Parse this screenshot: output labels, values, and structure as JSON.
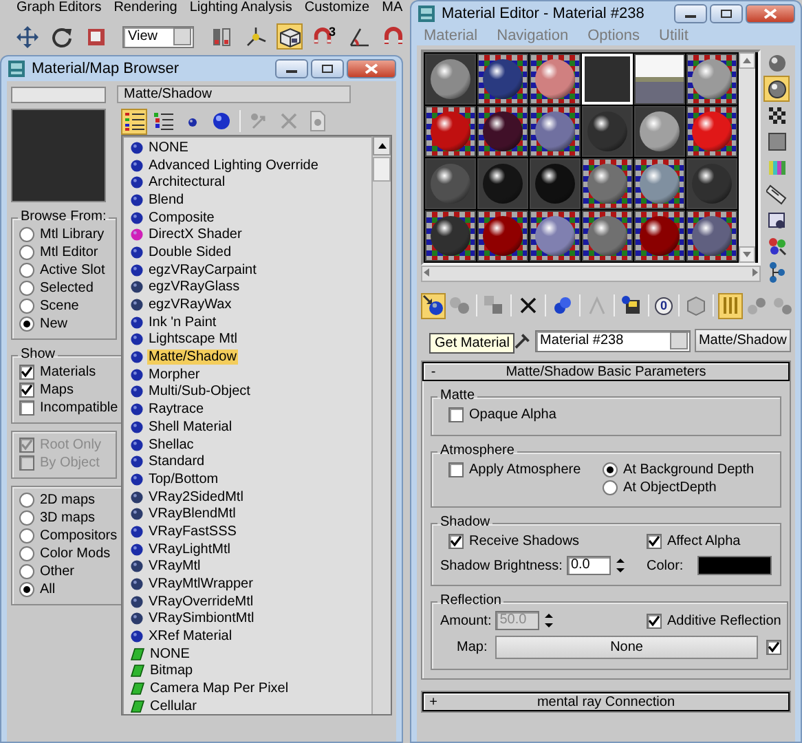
{
  "main_menu": [
    "Graph Editors",
    "Rendering",
    "Lighting Analysis",
    "Customize",
    "MA"
  ],
  "main_toolbar": {
    "tools": [
      {
        "active": false
      },
      {
        "active": false
      },
      {
        "active": false
      },
      {
        "active": false
      },
      {
        "active": false
      },
      {
        "active": true
      },
      {
        "active": false
      },
      {
        "active": false
      },
      {
        "active": false
      }
    ],
    "view": "View",
    "snap_label": "3"
  },
  "browser": {
    "title": "Material/Map Browser",
    "type_field": "Matte/Shadow",
    "toolbar": [
      {
        "active": true
      },
      {
        "active": false
      },
      {
        "active": false
      },
      {
        "active": false
      },
      {
        "active": false
      },
      {
        "active": false
      },
      {
        "active": false
      }
    ],
    "browse_from": {
      "title": "Browse From:",
      "options": [
        {
          "label": "Mtl Library",
          "selected": false
        },
        {
          "label": "Mtl Editor",
          "selected": false
        },
        {
          "label": "Active Slot",
          "selected": false
        },
        {
          "label": "Selected",
          "selected": false
        },
        {
          "label": "Scene",
          "selected": false
        },
        {
          "label": "New",
          "selected": true
        }
      ]
    },
    "show": {
      "title": "Show",
      "options": [
        {
          "label": "Materials",
          "checked": true
        },
        {
          "label": "Maps",
          "checked": true
        },
        {
          "label": "Incompatible",
          "checked": false
        }
      ]
    },
    "hierarchy": [
      {
        "label": "Root Only",
        "checked": true,
        "disabled": true
      },
      {
        "label": "By Object",
        "checked": false,
        "disabled": true
      }
    ],
    "categories": [
      {
        "label": "2D maps",
        "selected": false
      },
      {
        "label": "3D maps",
        "selected": false
      },
      {
        "label": "Compositors",
        "selected": false
      },
      {
        "label": "Color Mods",
        "selected": false
      },
      {
        "label": "Other",
        "selected": false
      },
      {
        "label": "All",
        "selected": true
      }
    ],
    "items": [
      {
        "label": "NONE",
        "kind": "material",
        "color": "#1c2da8",
        "selected": false
      },
      {
        "label": "Advanced Lighting Override",
        "kind": "material",
        "color": "#1c2da8",
        "selected": false
      },
      {
        "label": "Architectural",
        "kind": "material",
        "color": "#1c2da8",
        "selected": false
      },
      {
        "label": "Blend",
        "kind": "material",
        "color": "#1c2da8",
        "selected": false
      },
      {
        "label": "Composite",
        "kind": "material",
        "color": "#1c2da8",
        "selected": false
      },
      {
        "label": "DirectX Shader",
        "kind": "material",
        "color": "#d020b8",
        "selected": false
      },
      {
        "label": "Double Sided",
        "kind": "material",
        "color": "#1c2da8",
        "selected": false
      },
      {
        "label": "egzVRayCarpaint",
        "kind": "material",
        "color": "#1c2da8",
        "selected": false
      },
      {
        "label": "egzVRayGlass",
        "kind": "material",
        "color": "#2c3c6c",
        "selected": false
      },
      {
        "label": "egzVRayWax",
        "kind": "material",
        "color": "#2c3c6c",
        "selected": false
      },
      {
        "label": "Ink 'n Paint",
        "kind": "material",
        "color": "#1c2da8",
        "selected": false
      },
      {
        "label": "Lightscape Mtl",
        "kind": "material",
        "color": "#1c2da8",
        "selected": false
      },
      {
        "label": "Matte/Shadow",
        "kind": "material",
        "color": "#1c2da8",
        "selected": true
      },
      {
        "label": "Morpher",
        "kind": "material",
        "color": "#1c2da8",
        "selected": false
      },
      {
        "label": "Multi/Sub-Object",
        "kind": "material",
        "color": "#1c2da8",
        "selected": false
      },
      {
        "label": "Raytrace",
        "kind": "material",
        "color": "#1c2da8",
        "selected": false
      },
      {
        "label": "Shell Material",
        "kind": "material",
        "color": "#1c2da8",
        "selected": false
      },
      {
        "label": "Shellac",
        "kind": "material",
        "color": "#1c2da8",
        "selected": false
      },
      {
        "label": "Standard",
        "kind": "material",
        "color": "#1c2da8",
        "selected": false
      },
      {
        "label": "Top/Bottom",
        "kind": "material",
        "color": "#1c2da8",
        "selected": false
      },
      {
        "label": "VRay2SidedMtl",
        "kind": "material",
        "color": "#2c3c6c",
        "selected": false
      },
      {
        "label": "VRayBlendMtl",
        "kind": "material",
        "color": "#2c3c6c",
        "selected": false
      },
      {
        "label": "VRayFastSSS",
        "kind": "material",
        "color": "#1c2da8",
        "selected": false
      },
      {
        "label": "VRayLightMtl",
        "kind": "material",
        "color": "#1c2da8",
        "selected": false
      },
      {
        "label": "VRayMtl",
        "kind": "material",
        "color": "#2c3c6c",
        "selected": false
      },
      {
        "label": "VRayMtlWrapper",
        "kind": "material",
        "color": "#2c3c6c",
        "selected": false
      },
      {
        "label": "VRayOverrideMtl",
        "kind": "material",
        "color": "#2c3c6c",
        "selected": false
      },
      {
        "label": "VRaySimbiontMtl",
        "kind": "material",
        "color": "#2c3c6c",
        "selected": false
      },
      {
        "label": "XRef Material",
        "kind": "material",
        "color": "#1c2da8",
        "selected": false
      },
      {
        "label": "NONE",
        "kind": "map",
        "color": "#2fb52f",
        "selected": false
      },
      {
        "label": "Bitmap",
        "kind": "map",
        "color": "#2fb52f",
        "selected": false
      },
      {
        "label": "Camera Map Per Pixel",
        "kind": "map",
        "color": "#2fb52f",
        "selected": false
      },
      {
        "label": "Cellular",
        "kind": "map",
        "color": "#2fb52f",
        "selected": false
      }
    ]
  },
  "editor": {
    "title": "Material Editor - Material #238",
    "menu": [
      "Material",
      "Navigation",
      "Options",
      "Utilit"
    ],
    "slots": [
      {
        "kind": "sphere",
        "color": "#8a8a8a",
        "selected": false
      },
      {
        "kind": "checker",
        "color": "#2a3a80",
        "selected": false
      },
      {
        "kind": "checker",
        "color": "#d08080",
        "selected": false
      },
      {
        "kind": "empty",
        "selected": true
      },
      {
        "kind": "photo",
        "selected": false
      },
      {
        "kind": "checker",
        "color": "#9a9a9a",
        "selected": false
      },
      {
        "kind": "checker",
        "color": "#c01010",
        "selected": false
      },
      {
        "kind": "checker",
        "color": "#401028",
        "selected": false
      },
      {
        "kind": "checker",
        "color": "#7070a0",
        "selected": false
      },
      {
        "kind": "sphere",
        "color": "#303030",
        "selected": false
      },
      {
        "kind": "sphere",
        "color": "#a0a0a0",
        "selected": false
      },
      {
        "kind": "checker",
        "color": "#e01818",
        "selected": false
      },
      {
        "kind": "sphere",
        "color": "#505050",
        "selected": false
      },
      {
        "kind": "sphere",
        "color": "#151515",
        "selected": false
      },
      {
        "kind": "sphere",
        "color": "#101010",
        "selected": false
      },
      {
        "kind": "checker",
        "color": "#707070",
        "selected": false
      },
      {
        "kind": "checker",
        "color": "#8090a0",
        "selected": false
      },
      {
        "kind": "sphere",
        "color": "#303030",
        "selected": false
      },
      {
        "kind": "checker",
        "color": "#303030",
        "selected": false
      },
      {
        "kind": "checker",
        "color": "#900000",
        "selected": false
      },
      {
        "kind": "checker",
        "color": "#8080b0",
        "selected": false
      },
      {
        "kind": "checker",
        "color": "#707070",
        "selected": false
      },
      {
        "kind": "checker",
        "color": "#8a0000",
        "selected": false
      },
      {
        "kind": "checker",
        "color": "#606080",
        "selected": false
      }
    ],
    "side_tools": [
      {
        "active": false
      },
      {
        "active": true
      },
      {
        "active": false
      },
      {
        "active": false
      },
      {
        "active": false
      },
      {
        "active": false
      },
      {
        "active": false
      },
      {
        "active": false
      },
      {
        "active": false
      }
    ],
    "toolbar": [
      {
        "active": true
      },
      {
        "active": false
      },
      {
        "active": false
      },
      {
        "active": false
      },
      {
        "active": false
      },
      {
        "active": false
      },
      {
        "active": false
      },
      {
        "active": false
      },
      {
        "active": false
      },
      {
        "active": true
      },
      {
        "active": false
      },
      {
        "active": false
      }
    ],
    "channel_id": "0",
    "tooltip": "Get Material",
    "material_name": "Material #238",
    "material_type": "Matte/Shadow",
    "basic": {
      "sign": "-",
      "title": "Matte/Shadow Basic Parameters",
      "matte": {
        "title": "Matte",
        "opaque_alpha": {
          "label": "Opaque Alpha",
          "checked": false
        }
      },
      "atmosphere": {
        "title": "Atmosphere",
        "apply": {
          "label": "Apply Atmosphere",
          "checked": false
        },
        "depth": [
          {
            "label": "At Background Depth",
            "selected": true
          },
          {
            "label": "At ObjectDepth",
            "selected": false
          }
        ]
      },
      "shadow": {
        "title": "Shadow",
        "receive": {
          "label": "Receive Shadows",
          "checked": true
        },
        "affect_alpha": {
          "label": "Affect Alpha",
          "checked": true
        },
        "brightness_label": "Shadow Brightness:",
        "brightness": "0.0",
        "color_label": "Color:",
        "color": "#000000"
      },
      "reflection": {
        "title": "Reflection",
        "amount_label": "Amount:",
        "amount": "50.0",
        "amount_disabled": true,
        "additive": {
          "label": "Additive Reflection",
          "checked": true
        },
        "map_label": "Map:",
        "map": "None",
        "map_toggle": {
          "checked": true
        }
      }
    },
    "mental_ray": {
      "sign": "+",
      "title": "mental ray Connection"
    }
  }
}
